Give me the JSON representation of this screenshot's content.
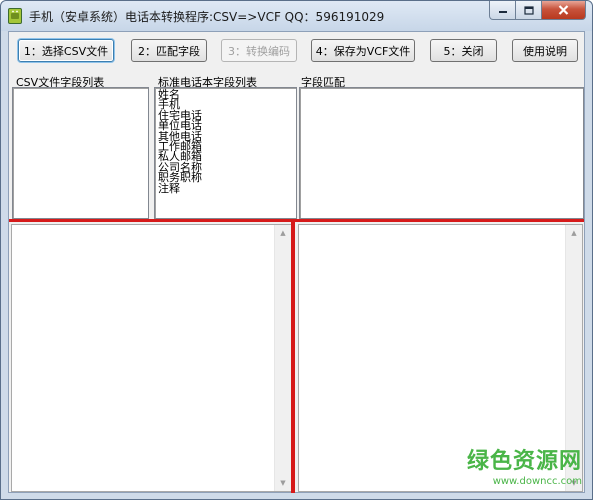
{
  "window": {
    "title": "手机（安卓系统）电话本转换程序:CSV=>VCF    QQ：596191029",
    "icon": "android-icon"
  },
  "toolbar": {
    "select_csv": "1：选择CSV文件",
    "match_fields": "2：匹配字段",
    "convert_encoding": "3：转换编码",
    "save_vcf": "4：保存为VCF文件",
    "close": "5：关闭",
    "help": "使用说明"
  },
  "panels": {
    "csv_fields_label": "CSV文件字段列表",
    "standard_fields_label": "标准电话本字段列表",
    "field_match_label": "字段匹配"
  },
  "standard_fields": [
    "姓名",
    "手机",
    "住宅电话",
    "单位电话",
    "其他电话",
    "工作邮箱",
    "私人邮箱",
    "公司名称",
    "职务职称",
    "注释"
  ],
  "watermark": {
    "main": "绿色资源网",
    "sub": "www.downcc.com"
  },
  "colors": {
    "separator": "#d61a1a",
    "watermark": "#4ab548",
    "frame": "#cfdbe9"
  }
}
